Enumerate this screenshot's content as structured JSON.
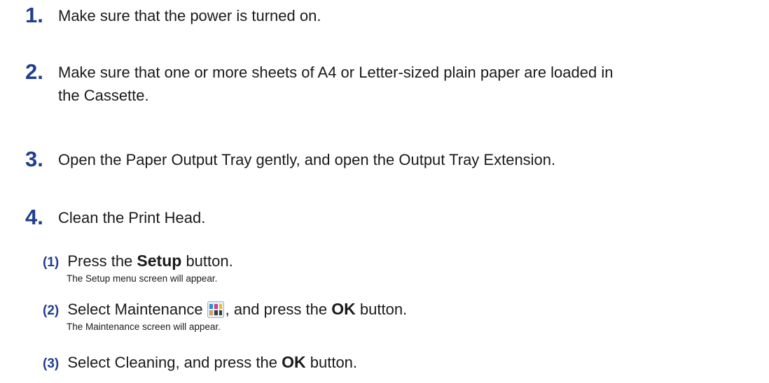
{
  "steps": [
    {
      "num": "1.",
      "text": "Make sure that the power is turned on."
    },
    {
      "num": "2.",
      "text_line1": "Make sure that one or more sheets of A4 or Letter-sized plain paper are loaded in",
      "text_line2": "the Cassette."
    },
    {
      "num": "3.",
      "text": "Open the Paper Output Tray gently, and open the Output Tray Extension."
    },
    {
      "num": "4.",
      "text": "Clean the Print Head."
    }
  ],
  "substeps": [
    {
      "num": "(1)",
      "pre": "Press the",
      "button": "Setup",
      "post": "button.",
      "note": "The Setup menu screen will appear."
    },
    {
      "num": "(2)",
      "pre": "Select Maintenance",
      "icon": "maintenance-icon",
      "mid": ", and press the",
      "button": "OK",
      "post": "button.",
      "note": "The Maintenance screen will appear."
    },
    {
      "num": "(3)",
      "pre": "Select Cleaning, and press the",
      "button": "OK",
      "post": "button."
    }
  ],
  "colors": {
    "step_number": "#1f3e8f",
    "text": "#1a1a1a"
  }
}
